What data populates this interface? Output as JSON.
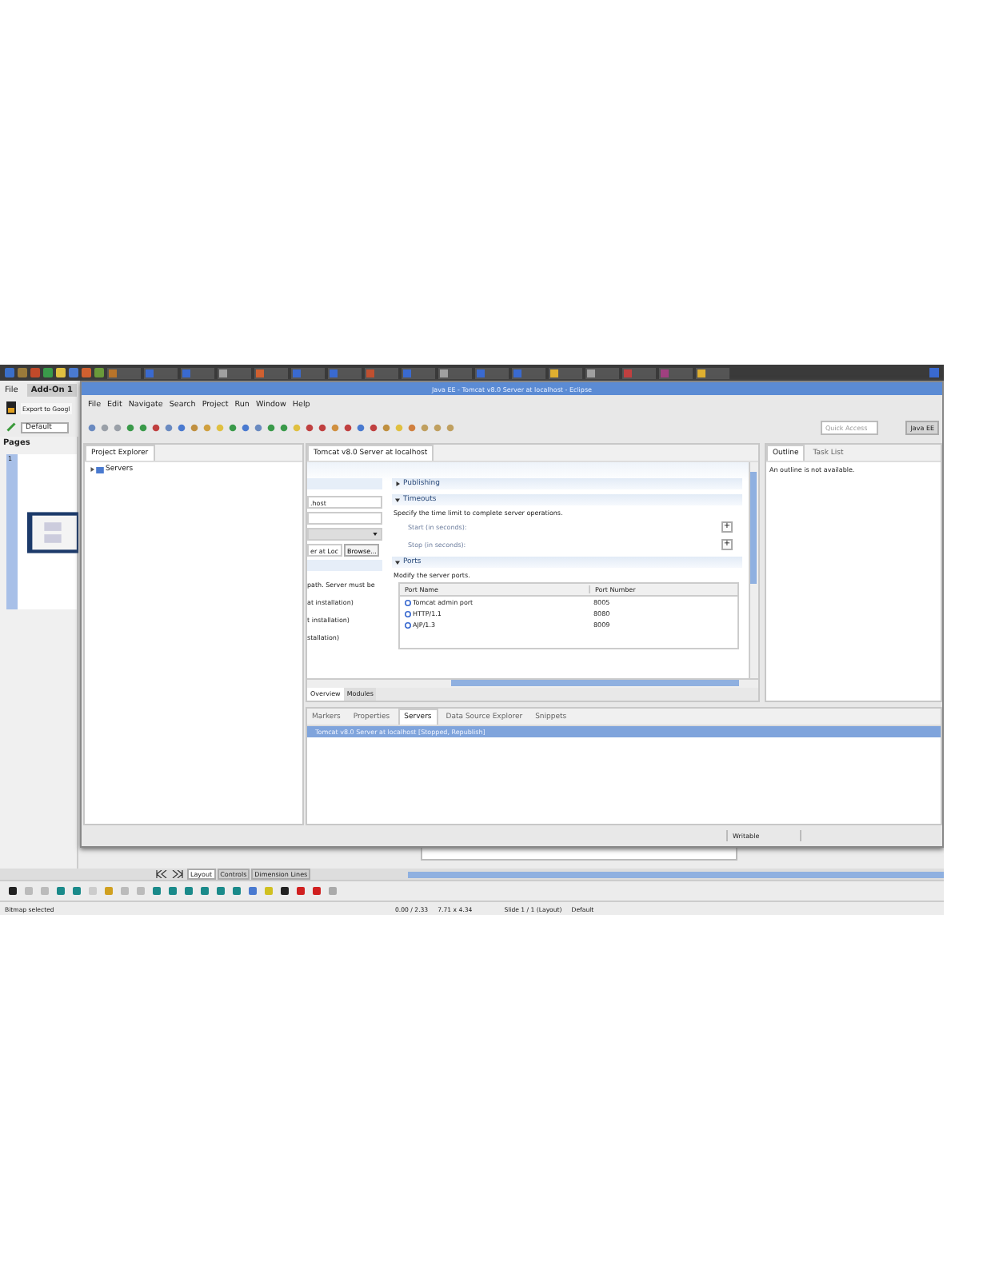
{
  "libreoffice": {
    "menu": [
      "File",
      "Add-On 1"
    ],
    "export_button": "Export to Googl",
    "layout_select": "Default",
    "pages_title": "Pages",
    "slide_number": "1",
    "sheet_tabs": [
      {
        "label": "Layout",
        "selected": true
      },
      {
        "label": "Controls",
        "selected": false
      },
      {
        "label": "Dimension Lines",
        "selected": false
      }
    ],
    "status": {
      "message": "Bitmap selected",
      "position": "0.00 / 2.33",
      "size": "7.71 x 4.34",
      "slide": "Slide 1 / 1 (Layout)",
      "master": "Default"
    }
  },
  "eclipse": {
    "title": "Java EE - Tomcat v8.0 Server at localhost - Eclipse",
    "menu": [
      "File",
      "Edit",
      "Navigate",
      "Search",
      "Project",
      "Run",
      "Window",
      "Help"
    ],
    "quick_access": {
      "placeholder": "Quick Access"
    },
    "perspective": "Java EE",
    "project_explorer": {
      "title": "Project Explorer",
      "tree": [
        {
          "label": "Servers",
          "expanded": false
        }
      ]
    },
    "editor": {
      "tab": "Tomcat v8.0 Server at localhost",
      "left_partial": [
        {
          "kind": "header"
        },
        {
          "kind": "field",
          "value": ".host"
        },
        {
          "kind": "field"
        },
        {
          "kind": "dropdown"
        },
        {
          "kind": "browse",
          "value": "er at Loc",
          "button": "Browse..."
        },
        {
          "kind": "header"
        },
        {
          "kind": "text",
          "text": "path. Server must be"
        },
        {
          "kind": "text",
          "text": "at installation)"
        },
        {
          "kind": "text",
          "text": "t installation)"
        },
        {
          "kind": "text",
          "text": "stallation)"
        }
      ],
      "sections": [
        {
          "title": "Publishing",
          "expanded": false
        },
        {
          "kind": "timeouts",
          "title": "Timeouts",
          "expanded": true,
          "description": "Specify the time limit to complete server operations.",
          "fields": [
            {
              "label": "Start (in seconds):",
              "button": "+"
            },
            {
              "label": "Stop (in seconds):",
              "button": "+"
            }
          ]
        },
        {
          "kind": "ports",
          "title": "Ports",
          "expanded": true,
          "description": "Modify the server ports.",
          "columns": [
            "Port Name",
            "Port Number"
          ],
          "rows": [
            {
              "name": "Tomcat admin port",
              "number": "8005"
            },
            {
              "name": "HTTP/1.1",
              "number": "8080"
            },
            {
              "name": "AJP/1.3",
              "number": "8009"
            }
          ]
        }
      ],
      "page_tabs": [
        {
          "label": "Overview",
          "selected": true
        },
        {
          "label": "Modules",
          "selected": false
        }
      ]
    },
    "outline": {
      "tabs": [
        {
          "label": "Outline",
          "selected": true
        },
        {
          "label": "Task List",
          "selected": false
        }
      ],
      "message": "An outline is not available."
    },
    "bottom": {
      "tabs": [
        {
          "label": "Markers",
          "selected": false
        },
        {
          "label": "Properties",
          "selected": false
        },
        {
          "label": "Servers",
          "selected": true
        },
        {
          "label": "Data Source Explorer",
          "selected": false
        },
        {
          "label": "Snippets",
          "selected": false
        }
      ],
      "servers": [
        {
          "label": "Tomcat v8.0 Server at localhost  [Stopped, Republish]",
          "selected": true
        }
      ]
    },
    "status": "Writable"
  }
}
